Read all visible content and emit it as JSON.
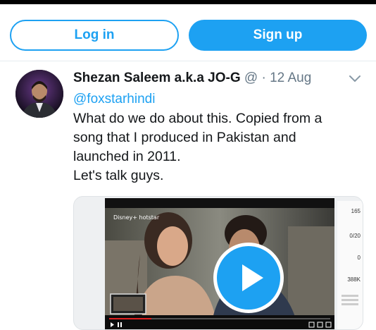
{
  "auth": {
    "login_label": "Log in",
    "signup_label": "Sign up"
  },
  "tweet": {
    "author_name": "Shezan Saleem a.k.a JO-G",
    "author_handle": "@",
    "separator": "·",
    "date": "12 Aug",
    "mention": "@foxstarhindi",
    "text_lines": [
      "What do we do about this. Copied from a",
      "song that I produced in Pakistan and",
      "launched in 2011.",
      "Let's talk guys."
    ]
  },
  "media": {
    "video_logo": "Disney+ hotstar",
    "stats": [
      "165",
      "0/20",
      "0",
      "388K"
    ]
  },
  "colors": {
    "accent": "#1da1f2",
    "text": "#14171a",
    "muted": "#657786"
  },
  "icons": [
    "chevron-down-icon",
    "play-icon"
  ]
}
